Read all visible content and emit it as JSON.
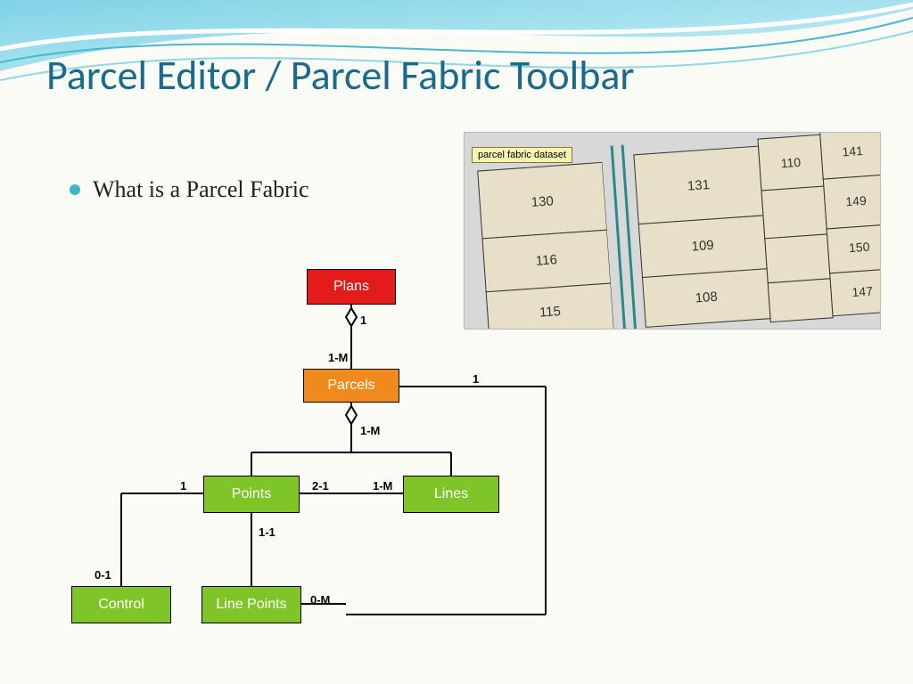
{
  "title": "Parcel Editor / Parcel Fabric Toolbar",
  "bullet": "What is a Parcel Fabric",
  "map_note": "parcel fabric dataset",
  "parcels": {
    "p130": "130",
    "p131": "131",
    "p110": "110",
    "p141": "141",
    "p116": "116",
    "p109": "109",
    "p149": "149",
    "p115": "115",
    "p108": "108",
    "p150": "150",
    "p147": "147"
  },
  "diagram": {
    "plans": "Plans",
    "parcels": "Parcels",
    "points": "Points",
    "lines": "Lines",
    "control": "Control",
    "linepoints": "Line Points",
    "card": {
      "one_a": "1",
      "one_b": "1",
      "one_c": "1",
      "one_m_a": "1-M",
      "one_m_b": "1-M",
      "one_m_c": "1-M",
      "two_one": "2-1",
      "one_one": "1-1",
      "zero_one": "0-1",
      "zero_m": "0-M"
    }
  }
}
